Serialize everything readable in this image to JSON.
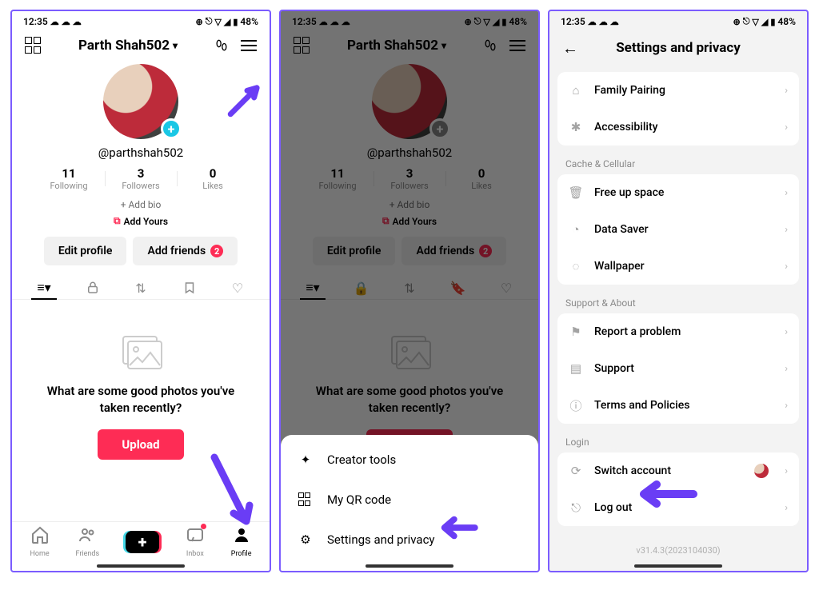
{
  "statusbar": {
    "time": "12:35",
    "battery": "48%"
  },
  "profile": {
    "display_name": "Parth Shah502",
    "username": "@parthshah502",
    "stats": {
      "following_num": "11",
      "following_lbl": "Following",
      "followers_num": "3",
      "followers_lbl": "Followers",
      "likes_num": "0",
      "likes_lbl": "Likes"
    },
    "add_bio": "+ Add bio",
    "add_yours": "Add Yours",
    "edit_profile": "Edit profile",
    "add_friends": "Add friends",
    "friends_badge": "2",
    "empty_text": "What are some good photos you've taken recently?",
    "upload": "Upload"
  },
  "navbar": {
    "home": "Home",
    "friends": "Friends",
    "inbox": "Inbox",
    "profile": "Profile"
  },
  "sheet": {
    "creator_tools": "Creator tools",
    "my_qr": "My QR code",
    "settings": "Settings and privacy"
  },
  "settings": {
    "title": "Settings and privacy",
    "family_pairing": "Family Pairing",
    "accessibility": "Accessibility",
    "grp_cache": "Cache & Cellular",
    "free_space": "Free up space",
    "data_saver": "Data Saver",
    "wallpaper": "Wallpaper",
    "grp_support": "Support & About",
    "report": "Report a problem",
    "support": "Support",
    "terms": "Terms and Policies",
    "grp_login": "Login",
    "switch": "Switch account",
    "logout": "Log out",
    "version": "v31.4.3(2023104030)"
  }
}
